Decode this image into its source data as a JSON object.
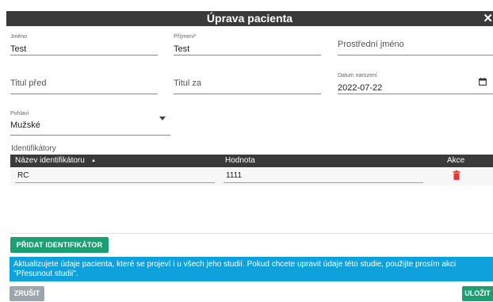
{
  "dialog": {
    "title": "Úprava pacienta"
  },
  "form": {
    "jmeno": {
      "label": "Jméno",
      "value": "Test"
    },
    "prijmeni": {
      "label": "Příjmení*",
      "value": "Test"
    },
    "prostredni": {
      "placeholder": "Prostřední jméno"
    },
    "titul_pred": {
      "placeholder": "Titul před"
    },
    "titul_za": {
      "placeholder": "Titul za"
    },
    "datum": {
      "label": "Datum narození",
      "value": "2022-07-22"
    },
    "pohlavi": {
      "label": "Pohlaví",
      "value": "Mužské"
    }
  },
  "identifiers": {
    "section_label": "Identifikátory",
    "columns": {
      "name": "Název identifikátoru",
      "value": "Hodnota",
      "actions": "Akce"
    },
    "sort_indicator": "▲",
    "rows": [
      {
        "name": "RC",
        "value": "1111"
      }
    ],
    "add_label": "PŘIDAT IDENTIFIKÁTOR"
  },
  "info_text": "Aktualizujete údaje pacienta, které se projeví i u všech jeho studií. Pokud chcete upravit údaje této studie, použijte prosím akci \"Přesunout studii\".",
  "footer": {
    "cancel_label": "ZRUŠIT",
    "save_label": "ULOŽIT"
  },
  "colors": {
    "header_bg": "#3a3a3a",
    "primary_green": "#1e9e73",
    "info_blue": "#0ea1dc",
    "cancel_grey": "#9ea6ad",
    "delete_red": "#e53935"
  },
  "icons": {
    "close": "close-icon",
    "calendar": "calendar-icon",
    "dropdown": "chevron-down-icon",
    "sort": "sort-asc-icon",
    "delete": "trash-icon"
  }
}
